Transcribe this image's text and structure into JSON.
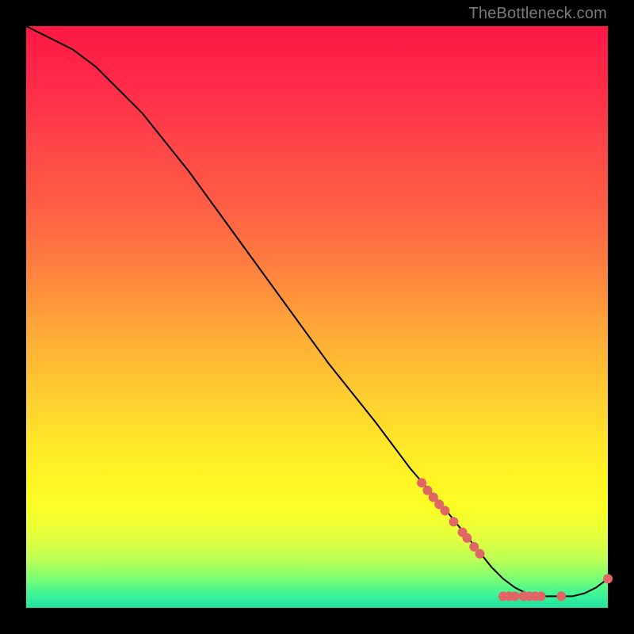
{
  "watermark": "TheBottleneck.com",
  "colors": {
    "background": "#000000",
    "curve_stroke": "#000000",
    "point_fill": "#e06666",
    "gradient_stops": [
      {
        "offset": 0.0,
        "color": "#ff1744"
      },
      {
        "offset": 0.1,
        "color": "#ff2b4a"
      },
      {
        "offset": 0.2,
        "color": "#ff4448"
      },
      {
        "offset": 0.3,
        "color": "#ff5c45"
      },
      {
        "offset": 0.4,
        "color": "#ff7a40"
      },
      {
        "offset": 0.5,
        "color": "#ffa039"
      },
      {
        "offset": 0.6,
        "color": "#ffc232"
      },
      {
        "offset": 0.7,
        "color": "#ffe22b"
      },
      {
        "offset": 0.77,
        "color": "#fff324"
      },
      {
        "offset": 0.83,
        "color": "#faff25"
      },
      {
        "offset": 0.88,
        "color": "#e3ff3e"
      },
      {
        "offset": 0.92,
        "color": "#b7ff57"
      },
      {
        "offset": 0.95,
        "color": "#7aff74"
      },
      {
        "offset": 0.975,
        "color": "#40f596"
      },
      {
        "offset": 1.0,
        "color": "#1fe3a0"
      }
    ]
  },
  "chart_data": {
    "type": "line",
    "title": "",
    "xlabel": "",
    "ylabel": "",
    "xlim": [
      0,
      100
    ],
    "ylim": [
      0,
      100
    ],
    "grid": false,
    "legend": false,
    "series": [
      {
        "name": "curve",
        "x": [
          0,
          4,
          8,
          12,
          16,
          20,
          28,
          36,
          44,
          52,
          60,
          66,
          72,
          76,
          80,
          82,
          84,
          86,
          88,
          90,
          92,
          94,
          96,
          98,
          100
        ],
        "y": [
          100,
          98,
          96,
          93,
          89,
          85,
          75,
          64,
          53,
          42,
          32,
          24,
          17,
          12,
          7,
          5,
          3.5,
          2.5,
          2,
          2,
          2,
          2,
          2.5,
          3.5,
          5
        ]
      }
    ],
    "points": [
      {
        "x": 68,
        "y": 21.5
      },
      {
        "x": 69,
        "y": 20.2
      },
      {
        "x": 70,
        "y": 19.0
      },
      {
        "x": 71,
        "y": 17.8
      },
      {
        "x": 72,
        "y": 16.7
      },
      {
        "x": 73.5,
        "y": 14.8
      },
      {
        "x": 75,
        "y": 13.0
      },
      {
        "x": 75.8,
        "y": 12.0
      },
      {
        "x": 77,
        "y": 10.5
      },
      {
        "x": 78,
        "y": 9.3
      },
      {
        "x": 82,
        "y": 2.0
      },
      {
        "x": 83,
        "y": 2.0
      },
      {
        "x": 84,
        "y": 2.0
      },
      {
        "x": 85.5,
        "y": 2.0
      },
      {
        "x": 86.5,
        "y": 2.0
      },
      {
        "x": 87.5,
        "y": 2.0
      },
      {
        "x": 88.5,
        "y": 2.0
      },
      {
        "x": 92,
        "y": 2.0
      },
      {
        "x": 100,
        "y": 5.0
      }
    ]
  }
}
